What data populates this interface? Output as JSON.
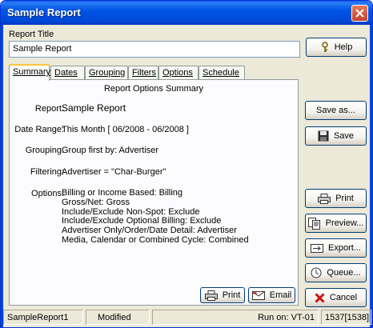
{
  "window": {
    "title": "Sample Report"
  },
  "report_title": {
    "label": "Report Title",
    "value": "Sample Report"
  },
  "tabs": [
    {
      "label": "Summary"
    },
    {
      "label": "Dates"
    },
    {
      "label": "Grouping"
    },
    {
      "label": "Filters"
    },
    {
      "label": "Options"
    },
    {
      "label": "Schedule"
    }
  ],
  "summary": {
    "heading": "Report Options Summary",
    "report_label": "Report:",
    "report_value": "Sample Report",
    "date_label": "Date Range:",
    "date_value": "This Month [ 06/2008 - 06/2008 ]",
    "grouping_label": "Grouping:",
    "grouping_value": "Group first by: Advertiser",
    "filtering_label": "Filtering:",
    "filtering_value": "Advertiser  = \"Char-Burger\"",
    "options_label": "Options:",
    "options": [
      "Billing or Income Based:  Billing",
      "Gross/Net:  Gross",
      "Include/Exclude Non-Spot:  Exclude",
      "Include/Exclude Optional Billing:  Exclude",
      "Advertiser Only/Order/Date Detail:  Advertiser",
      "Media, Calendar or Combined Cycle:  Combined"
    ]
  },
  "panel_buttons": {
    "print": "Print",
    "email": "Email"
  },
  "side_buttons": {
    "help": "Help",
    "save_as": "Save as...",
    "save": "Save",
    "print": "Print",
    "preview": "Preview...",
    "export": "Export...",
    "queue": "Queue...",
    "cancel": "Cancel"
  },
  "status": {
    "name": "SampleReport1",
    "state": "Modified",
    "run_on": "Run on:  VT-01",
    "count": "1537[1538]"
  }
}
